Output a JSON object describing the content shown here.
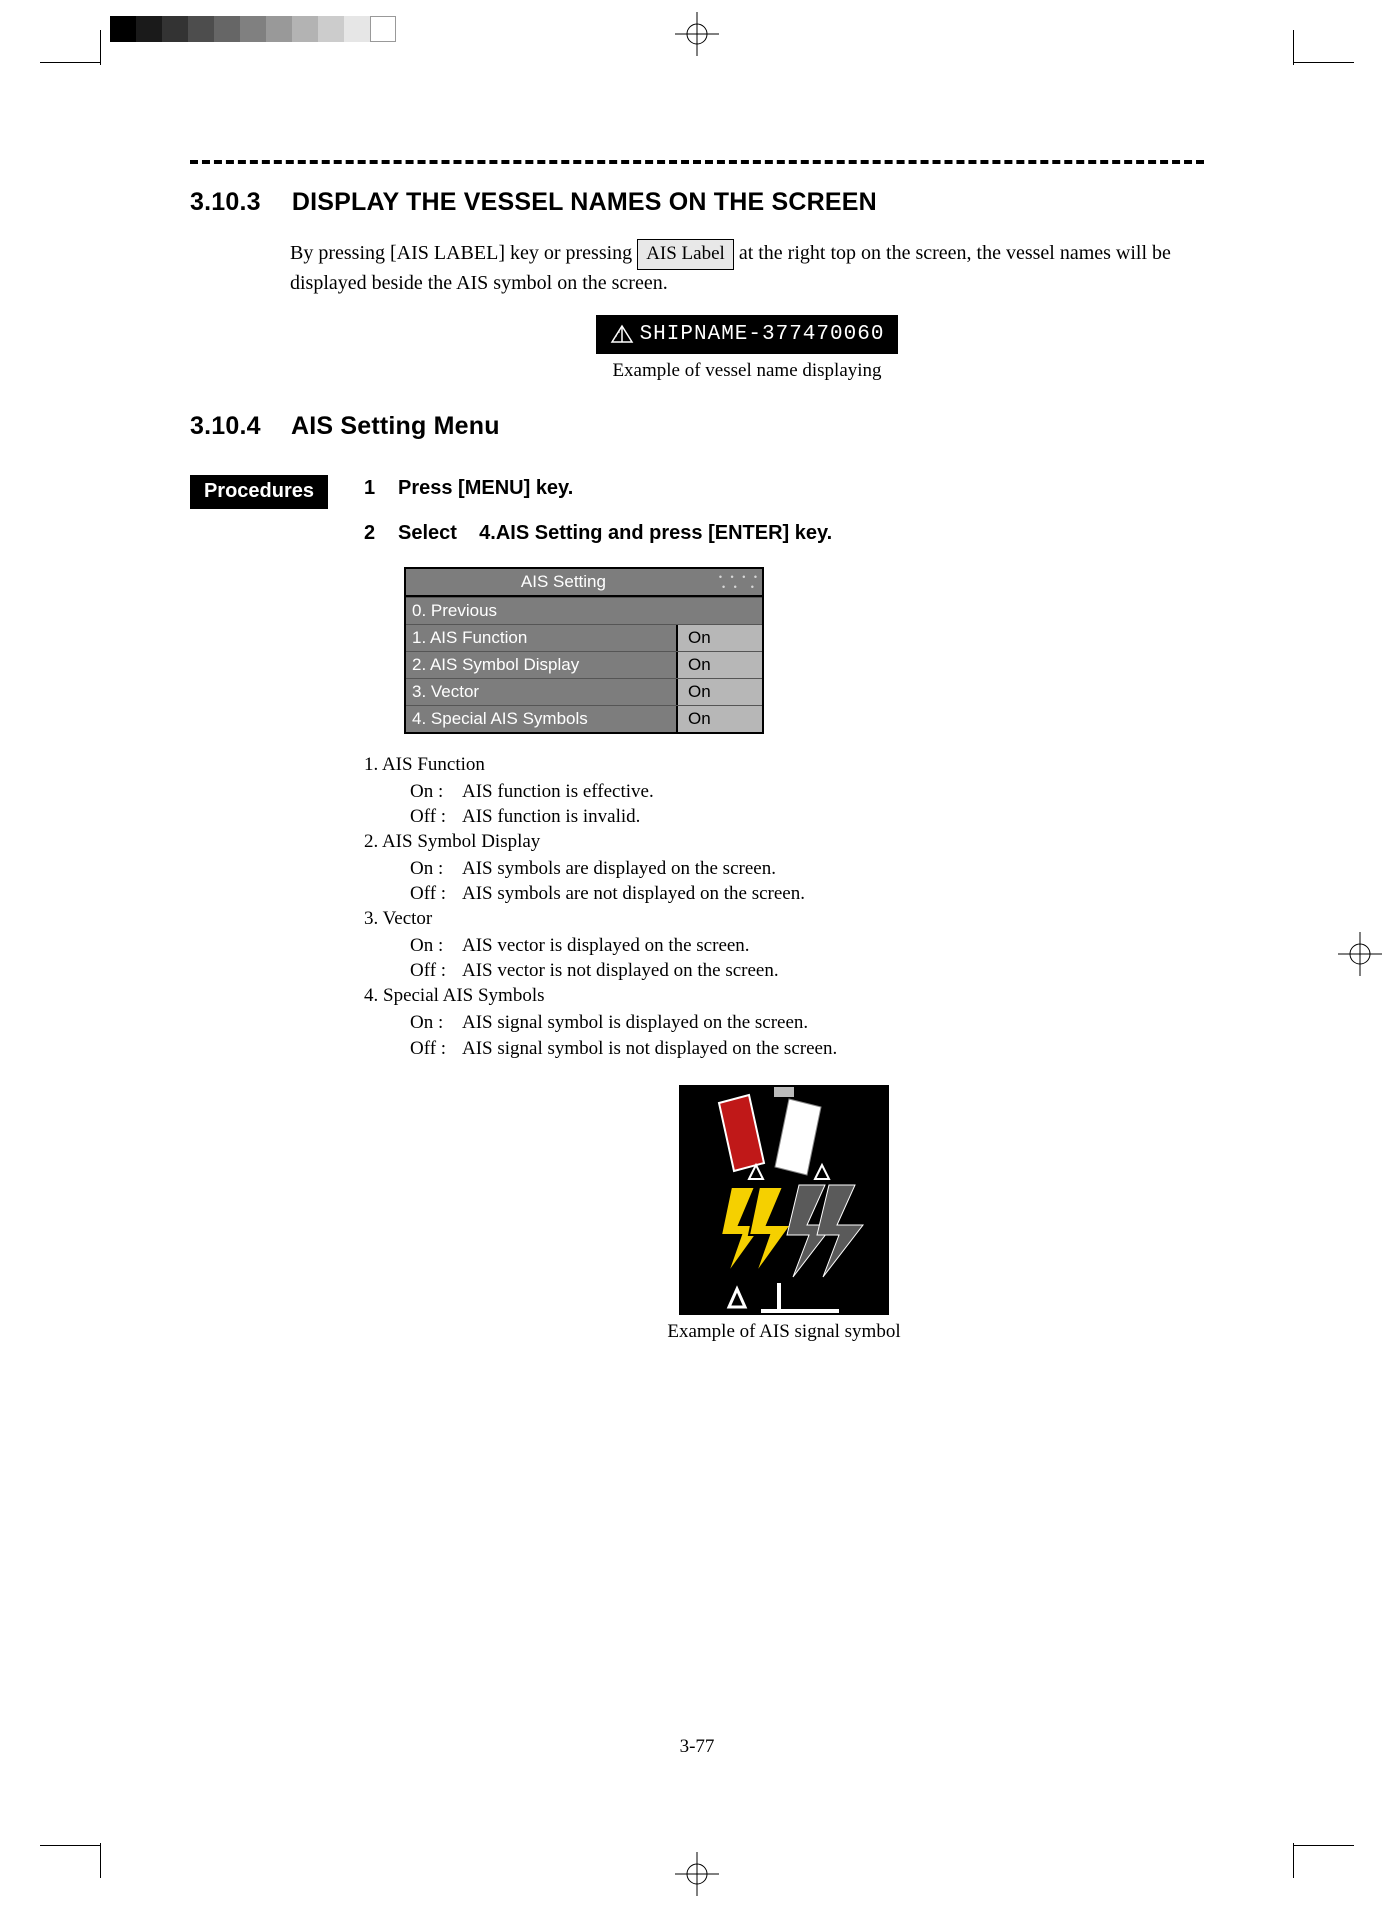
{
  "sections": {
    "s1": {
      "num": "3.10.3",
      "title": "DISPLAY THE VESSEL NAMES ON THE SCREEN"
    },
    "s2": {
      "num": "3.10.4",
      "title": "AIS Setting Menu"
    }
  },
  "para1": {
    "p1a": "By pressing [AIS LABEL] key or pressing ",
    "btn": "AIS Label",
    "p1b": " at the right top on the screen, the vessel names will be displayed beside the AIS symbol on the screen."
  },
  "shipname": "SHIPNAME-377470060",
  "fig1_caption": "Example of vessel name displaying",
  "procedures_label": "Procedures",
  "steps": {
    "s1n": "1",
    "s1t": "Press [MENU] key.",
    "s2n": "2",
    "s2t": "Select    4.AIS Setting and press [ENTER] key."
  },
  "menu": {
    "title": "AIS Setting",
    "rows": [
      {
        "label": "0. Previous",
        "full": true
      },
      {
        "label": "1. AIS Function",
        "value": "On"
      },
      {
        "label": "2. AIS Symbol Display",
        "value": "On"
      },
      {
        "label": "3. Vector",
        "value": "On"
      },
      {
        "label": "4. Special AIS Symbols",
        "value": "On"
      }
    ]
  },
  "explain": {
    "i1": "1. AIS Function",
    "i1a": "AIS function is effective.",
    "i1b": "AIS function is invalid.",
    "i2": "2. AIS Symbol Display",
    "i2a": "AIS symbols are displayed on the screen.",
    "i2b": "AIS symbols are not displayed on the screen.",
    "i3": "3. Vector",
    "i3a": "AIS vector is displayed on the screen.",
    "i3b": "AIS vector is not displayed on the screen.",
    "i4": "4. Special AIS Symbols",
    "i4a": "AIS signal symbol is displayed on the screen.",
    "i4b": "AIS signal symbol is not displayed on the screen.",
    "on": "On :",
    "off": "Off :"
  },
  "fig2_caption": "Example of AIS signal symbol",
  "page_number": "3-77"
}
